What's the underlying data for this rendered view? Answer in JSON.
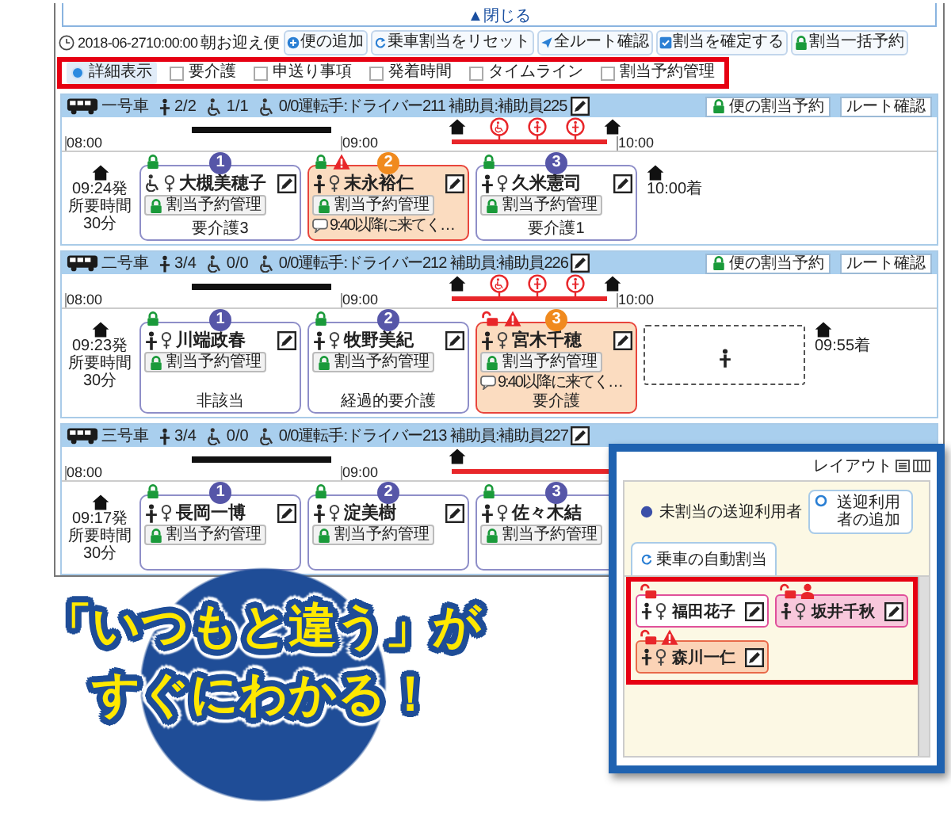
{
  "panel_toggle": "▲閉じる",
  "toolbar": {
    "datetime": "2018-06-2710:00:00",
    "trip": "朝お迎え便",
    "buttons": [
      {
        "label": "便の追加",
        "kind": "add"
      },
      {
        "label": "乗車割当をリセット",
        "kind": "reset"
      },
      {
        "label": "全ルート確認",
        "kind": "route"
      },
      {
        "label": "割当を確定する",
        "kind": "confirm"
      },
      {
        "label": "割当一括予約",
        "kind": "reserve"
      }
    ]
  },
  "view_options": [
    {
      "label": "詳細表示",
      "kind": "radio",
      "checked": true
    },
    {
      "label": "要介護",
      "kind": "checkbox",
      "checked": false
    },
    {
      "label": "申送り事項",
      "kind": "checkbox",
      "checked": false
    },
    {
      "label": "発着時間",
      "kind": "checkbox",
      "checked": false
    },
    {
      "label": "タイムライン",
      "kind": "checkbox",
      "checked": false
    },
    {
      "label": "割当予約管理",
      "kind": "checkbox",
      "checked": false
    }
  ],
  "vehicles": [
    {
      "name": "一号車",
      "seats": "2/2",
      "wheelchair_seats": "1/1",
      "staff": "0/0運転手:ドライバー211 補助員:補助員225",
      "buttons": [
        {
          "label": "便の割当予約",
          "kind": "reserve"
        },
        {
          "label": "ルート確認",
          "kind": "route"
        }
      ],
      "timeline": {
        "ticks": [
          "08:00",
          "09:00",
          "10:00"
        ],
        "stops": [
          {
            "kind": "wheelchair"
          },
          {
            "kind": "walk"
          },
          {
            "kind": "walk"
          }
        ],
        "route_end": true
      },
      "departure": "09:24発",
      "duration_label": "所要時間",
      "duration": "30分",
      "cards": [
        {
          "kind": "passenger",
          "number": "1",
          "name": "大槻美穂子",
          "wheelchair": true,
          "alert": false,
          "locked": true,
          "warning": false,
          "editable": true,
          "badge": "割当予約管理",
          "care_level": "要介護3"
        },
        {
          "kind": "passenger",
          "number": "2",
          "name": "末永裕仁",
          "wheelchair": false,
          "alert": true,
          "locked": true,
          "warning": true,
          "editable": true,
          "badge": "割当予約管理",
          "note": "9:40以降に来てく…"
        },
        {
          "kind": "passenger",
          "number": "3",
          "name": "久米憲司",
          "wheelchair": false,
          "alert": false,
          "locked": true,
          "warning": false,
          "editable": true,
          "badge": "割当予約管理",
          "care_level": "要介護1"
        }
      ],
      "arrival": "10:00着"
    },
    {
      "name": "二号車",
      "seats": "3/4",
      "wheelchair_seats": "0/0",
      "staff": "0/0運転手:ドライバー212 補助員:補助員226",
      "buttons": [
        {
          "label": "便の割当予約",
          "kind": "reserve"
        },
        {
          "label": "ルート確認",
          "kind": "route"
        }
      ],
      "timeline": {
        "ticks": [
          "08:00",
          "09:00",
          "10:00"
        ],
        "stops": [
          {
            "kind": "wheelchair"
          },
          {
            "kind": "walk"
          },
          {
            "kind": "walk"
          }
        ],
        "route_end": true
      },
      "departure": "09:23発",
      "duration_label": "所要時間",
      "duration": "30分",
      "cards": [
        {
          "kind": "passenger",
          "number": "1",
          "name": "川端政春",
          "wheelchair": false,
          "alert": false,
          "locked": true,
          "warning": false,
          "editable": true,
          "badge": "割当予約管理",
          "care_level": "非該当"
        },
        {
          "kind": "passenger",
          "number": "2",
          "name": "牧野美紀",
          "wheelchair": false,
          "alert": false,
          "locked": true,
          "warning": false,
          "editable": true,
          "badge": "割当予約管理",
          "care_level": "経過的要介護"
        },
        {
          "kind": "passenger",
          "number": "3",
          "name": "宮木千穂",
          "wheelchair": false,
          "alert": true,
          "locked": false,
          "warning": true,
          "editable": true,
          "badge": "割当予約管理",
          "note": "9:40以降に来てく…",
          "care_level": "要介護"
        },
        {
          "kind": "empty"
        }
      ],
      "arrival": "09:55着"
    },
    {
      "name": "三号車",
      "seats": "3/4",
      "wheelchair_seats": "0/0",
      "staff": "0/0運転手:ドライバー213 補助員:補助員227",
      "timeline": {
        "ticks": [
          "08:00",
          "09:00"
        ],
        "route_end": false
      },
      "departure": "09:17発",
      "duration_label": "所要時間",
      "duration": "30分",
      "cards": [
        {
          "kind": "passenger",
          "number": "1",
          "name": "長岡一博",
          "wheelchair": false,
          "alert": false,
          "locked": true,
          "warning": false,
          "editable": true,
          "badge": "割当予約管理"
        },
        {
          "kind": "passenger",
          "number": "2",
          "name": "淀美樹",
          "wheelchair": false,
          "alert": false,
          "locked": true,
          "warning": false,
          "editable": true,
          "badge": "割当予約管理"
        },
        {
          "kind": "passenger",
          "number": "3",
          "name": "佐々木結",
          "wheelchair": false,
          "alert": false,
          "locked": true,
          "warning": false,
          "editable": false,
          "badge": "割当予約管理"
        }
      ]
    }
  ],
  "popup": {
    "layout_label": "レイアウト",
    "legend": "未割当の送迎利用者",
    "add_button": "送迎利用者の追加",
    "auto_assign_button": "乗車の自動割当",
    "cards": [
      {
        "name": "福田花子",
        "kind": "plain",
        "locked": false
      },
      {
        "name": "坂井千秋",
        "kind": "changed",
        "locked": false
      },
      {
        "name": "森川一仁",
        "kind": "alert",
        "locked": false
      }
    ]
  },
  "callout": {
    "lines": [
      "「いつもと違う」が",
      "すぐにわかる！"
    ]
  }
}
